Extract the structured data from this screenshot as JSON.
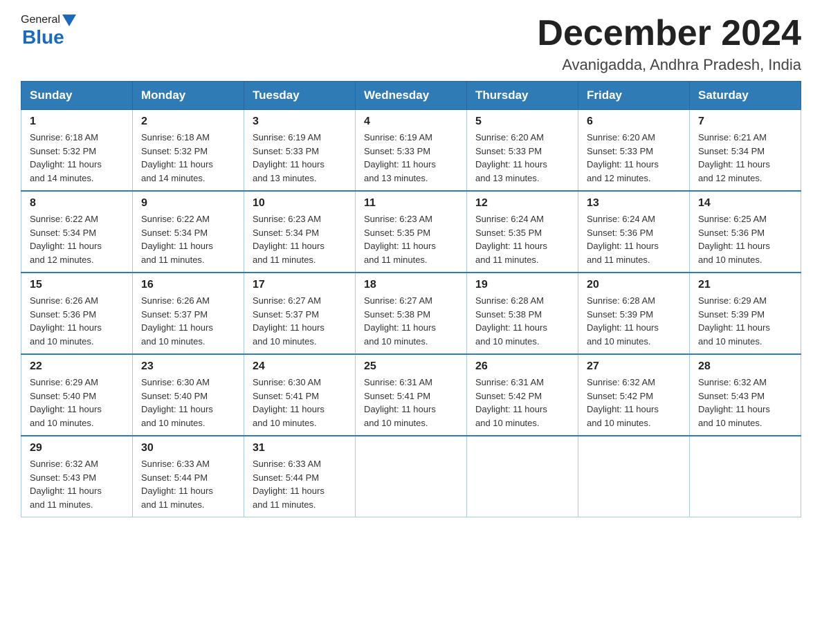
{
  "header": {
    "logo_general": "General",
    "logo_blue": "Blue",
    "month_title": "December 2024",
    "location": "Avanigadda, Andhra Pradesh, India"
  },
  "days_of_week": [
    "Sunday",
    "Monday",
    "Tuesday",
    "Wednesday",
    "Thursday",
    "Friday",
    "Saturday"
  ],
  "weeks": [
    [
      {
        "day": "1",
        "sunrise": "6:18 AM",
        "sunset": "5:32 PM",
        "daylight": "11 hours and 14 minutes."
      },
      {
        "day": "2",
        "sunrise": "6:18 AM",
        "sunset": "5:32 PM",
        "daylight": "11 hours and 14 minutes."
      },
      {
        "day": "3",
        "sunrise": "6:19 AM",
        "sunset": "5:33 PM",
        "daylight": "11 hours and 13 minutes."
      },
      {
        "day": "4",
        "sunrise": "6:19 AM",
        "sunset": "5:33 PM",
        "daylight": "11 hours and 13 minutes."
      },
      {
        "day": "5",
        "sunrise": "6:20 AM",
        "sunset": "5:33 PM",
        "daylight": "11 hours and 13 minutes."
      },
      {
        "day": "6",
        "sunrise": "6:20 AM",
        "sunset": "5:33 PM",
        "daylight": "11 hours and 12 minutes."
      },
      {
        "day": "7",
        "sunrise": "6:21 AM",
        "sunset": "5:34 PM",
        "daylight": "11 hours and 12 minutes."
      }
    ],
    [
      {
        "day": "8",
        "sunrise": "6:22 AM",
        "sunset": "5:34 PM",
        "daylight": "11 hours and 12 minutes."
      },
      {
        "day": "9",
        "sunrise": "6:22 AM",
        "sunset": "5:34 PM",
        "daylight": "11 hours and 11 minutes."
      },
      {
        "day": "10",
        "sunrise": "6:23 AM",
        "sunset": "5:34 PM",
        "daylight": "11 hours and 11 minutes."
      },
      {
        "day": "11",
        "sunrise": "6:23 AM",
        "sunset": "5:35 PM",
        "daylight": "11 hours and 11 minutes."
      },
      {
        "day": "12",
        "sunrise": "6:24 AM",
        "sunset": "5:35 PM",
        "daylight": "11 hours and 11 minutes."
      },
      {
        "day": "13",
        "sunrise": "6:24 AM",
        "sunset": "5:36 PM",
        "daylight": "11 hours and 11 minutes."
      },
      {
        "day": "14",
        "sunrise": "6:25 AM",
        "sunset": "5:36 PM",
        "daylight": "11 hours and 10 minutes."
      }
    ],
    [
      {
        "day": "15",
        "sunrise": "6:26 AM",
        "sunset": "5:36 PM",
        "daylight": "11 hours and 10 minutes."
      },
      {
        "day": "16",
        "sunrise": "6:26 AM",
        "sunset": "5:37 PM",
        "daylight": "11 hours and 10 minutes."
      },
      {
        "day": "17",
        "sunrise": "6:27 AM",
        "sunset": "5:37 PM",
        "daylight": "11 hours and 10 minutes."
      },
      {
        "day": "18",
        "sunrise": "6:27 AM",
        "sunset": "5:38 PM",
        "daylight": "11 hours and 10 minutes."
      },
      {
        "day": "19",
        "sunrise": "6:28 AM",
        "sunset": "5:38 PM",
        "daylight": "11 hours and 10 minutes."
      },
      {
        "day": "20",
        "sunrise": "6:28 AM",
        "sunset": "5:39 PM",
        "daylight": "11 hours and 10 minutes."
      },
      {
        "day": "21",
        "sunrise": "6:29 AM",
        "sunset": "5:39 PM",
        "daylight": "11 hours and 10 minutes."
      }
    ],
    [
      {
        "day": "22",
        "sunrise": "6:29 AM",
        "sunset": "5:40 PM",
        "daylight": "11 hours and 10 minutes."
      },
      {
        "day": "23",
        "sunrise": "6:30 AM",
        "sunset": "5:40 PM",
        "daylight": "11 hours and 10 minutes."
      },
      {
        "day": "24",
        "sunrise": "6:30 AM",
        "sunset": "5:41 PM",
        "daylight": "11 hours and 10 minutes."
      },
      {
        "day": "25",
        "sunrise": "6:31 AM",
        "sunset": "5:41 PM",
        "daylight": "11 hours and 10 minutes."
      },
      {
        "day": "26",
        "sunrise": "6:31 AM",
        "sunset": "5:42 PM",
        "daylight": "11 hours and 10 minutes."
      },
      {
        "day": "27",
        "sunrise": "6:32 AM",
        "sunset": "5:42 PM",
        "daylight": "11 hours and 10 minutes."
      },
      {
        "day": "28",
        "sunrise": "6:32 AM",
        "sunset": "5:43 PM",
        "daylight": "11 hours and 10 minutes."
      }
    ],
    [
      {
        "day": "29",
        "sunrise": "6:32 AM",
        "sunset": "5:43 PM",
        "daylight": "11 hours and 11 minutes."
      },
      {
        "day": "30",
        "sunrise": "6:33 AM",
        "sunset": "5:44 PM",
        "daylight": "11 hours and 11 minutes."
      },
      {
        "day": "31",
        "sunrise": "6:33 AM",
        "sunset": "5:44 PM",
        "daylight": "11 hours and 11 minutes."
      },
      null,
      null,
      null,
      null
    ]
  ],
  "labels": {
    "sunrise": "Sunrise:",
    "sunset": "Sunset:",
    "daylight": "Daylight:"
  }
}
